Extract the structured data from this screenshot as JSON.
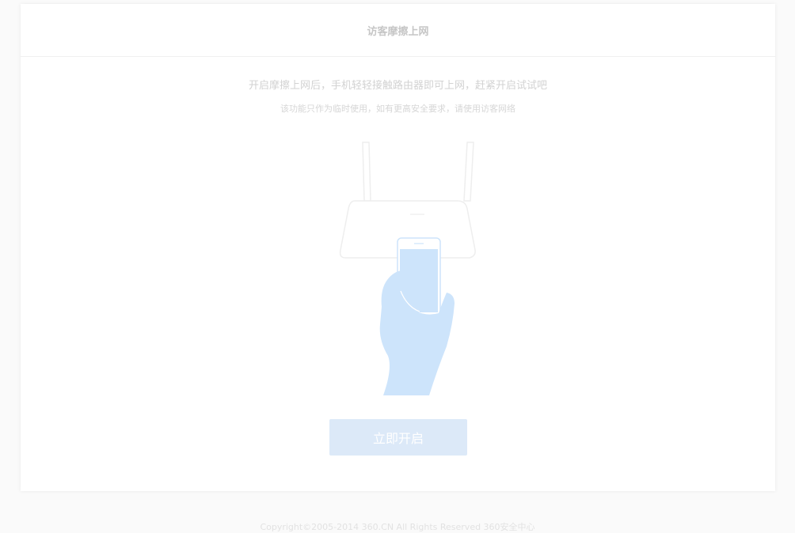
{
  "page": {
    "title": "访客摩擦上网",
    "description": "开启摩擦上网后，手机轻轻接触路由器即可上网，赶紧开启试试吧",
    "note": "该功能只作为临时使用，如有更高安全要求，请使用访客网络"
  },
  "illustration": {
    "icon": "router-phone-hand-icon",
    "accent_color": "#cde4fb"
  },
  "actions": {
    "enable_label": "立即开启",
    "enable_color": "#dce9f8"
  },
  "footer": {
    "copyright": "Copyright©2005-2014 360.CN All Rights Reserved 360安全中心"
  }
}
